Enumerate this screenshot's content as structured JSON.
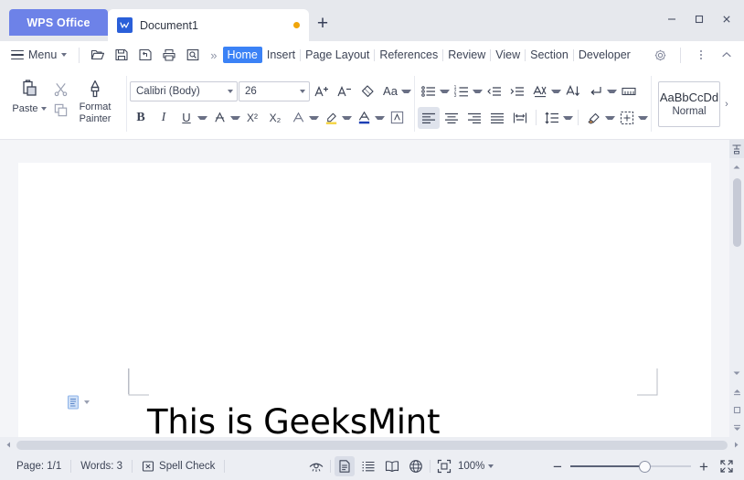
{
  "titlebar": {
    "brand": "WPS Office",
    "tab": {
      "name": "Document1",
      "icon": "wps-writer-icon",
      "modified_dot": "unsaved-indicator"
    },
    "new_tab_label": "+",
    "window_controls": {
      "minimize": "minimize-icon",
      "maximize": "maximize-icon",
      "close": "close-icon"
    }
  },
  "menubar": {
    "menu_label": "Menu",
    "quick_access": [
      "open-icon",
      "save-icon",
      "save-as-icon",
      "print-icon",
      "print-preview-icon"
    ],
    "overflow": "»",
    "tabs": [
      {
        "label": "Home",
        "active": true
      },
      {
        "label": "Insert",
        "active": false
      },
      {
        "label": "Page Layout",
        "active": false
      },
      {
        "label": "References",
        "active": false
      },
      {
        "label": "Review",
        "active": false
      },
      {
        "label": "View",
        "active": false
      },
      {
        "label": "Section",
        "active": false
      },
      {
        "label": "Developer",
        "active": false
      }
    ],
    "right_icons": [
      "settings-gear-icon",
      "more-options-icon",
      "collapse-ribbon-icon"
    ]
  },
  "ribbon": {
    "clipboard": {
      "paste_label": "Paste",
      "format_painter_line1": "Format",
      "format_painter_line2": "Painter",
      "cut_icon": "cut-icon",
      "copy_icon": "copy-icon",
      "paste_icon": "paste-icon",
      "format_painter_icon": "format-painter-icon"
    },
    "font": {
      "family_value": "Calibri (Body)",
      "size_value": "26",
      "grow_font": "grow-font-icon",
      "shrink_font": "shrink-font-icon",
      "clear_format": "clear-formatting-icon",
      "change_case": "change-case-icon",
      "bold": "B",
      "italic": "I",
      "underline": "U",
      "strikethrough": "strikethrough-icon",
      "superscript": "X²",
      "subscript": "X₂",
      "text_effects": "text-effects-icon",
      "highlight": "highlight-color-icon",
      "font_color": "font-color-icon",
      "char_border": "character-border-icon",
      "highlight_color": "#f5d547",
      "font_color_swatch": "#1d3fb5"
    },
    "paragraph": {
      "bullets": "bullet-list-icon",
      "numbering": "numbered-list-icon",
      "decrease_indent": "decrease-indent-icon",
      "increase_indent": "increase-indent-icon",
      "multilevel": "multilevel-list-icon",
      "sort": "sort-icon",
      "show_marks": "show-formatting-marks-icon",
      "paragraph_layout": "paragraph-layout-icon",
      "align_left": "align-left-icon",
      "align_center": "align-center-icon",
      "align_right": "align-right-icon",
      "justify": "justify-icon",
      "distribute": "distribute-icon",
      "line_spacing": "line-spacing-icon",
      "shading": "shading-icon",
      "borders": "borders-icon",
      "active_alignment": "align-left-icon"
    },
    "styles": {
      "preview_text": "AaBbCcDd",
      "name": "Normal",
      "more": "›"
    }
  },
  "document": {
    "body_text": "This is GeeksMint",
    "smart_tag_icon": "paste-options-icon"
  },
  "statusbar": {
    "page": "Page: 1/1",
    "words": "Words: 3",
    "spell_check": "Spell Check",
    "spell_check_icon": "spell-check-icon",
    "eye_icon": "reading-layout-icon",
    "view_modes": [
      {
        "icon": "print-layout-icon",
        "active": true
      },
      {
        "icon": "outline-view-icon",
        "active": false
      },
      {
        "icon": "reading-view-icon",
        "active": false
      },
      {
        "icon": "web-layout-icon",
        "active": false
      }
    ],
    "fit_icon": "fit-to-window-icon",
    "zoom_value": "100%",
    "zoom_out": "−",
    "zoom_in": "+",
    "fullscreen_icon": "fullscreen-icon"
  },
  "colors": {
    "brand_blue": "#6d82e8",
    "active_tab_blue": "#3b82f6",
    "chrome_gray": "#e6e8ed",
    "workspace_gray": "#f4f5f8"
  }
}
